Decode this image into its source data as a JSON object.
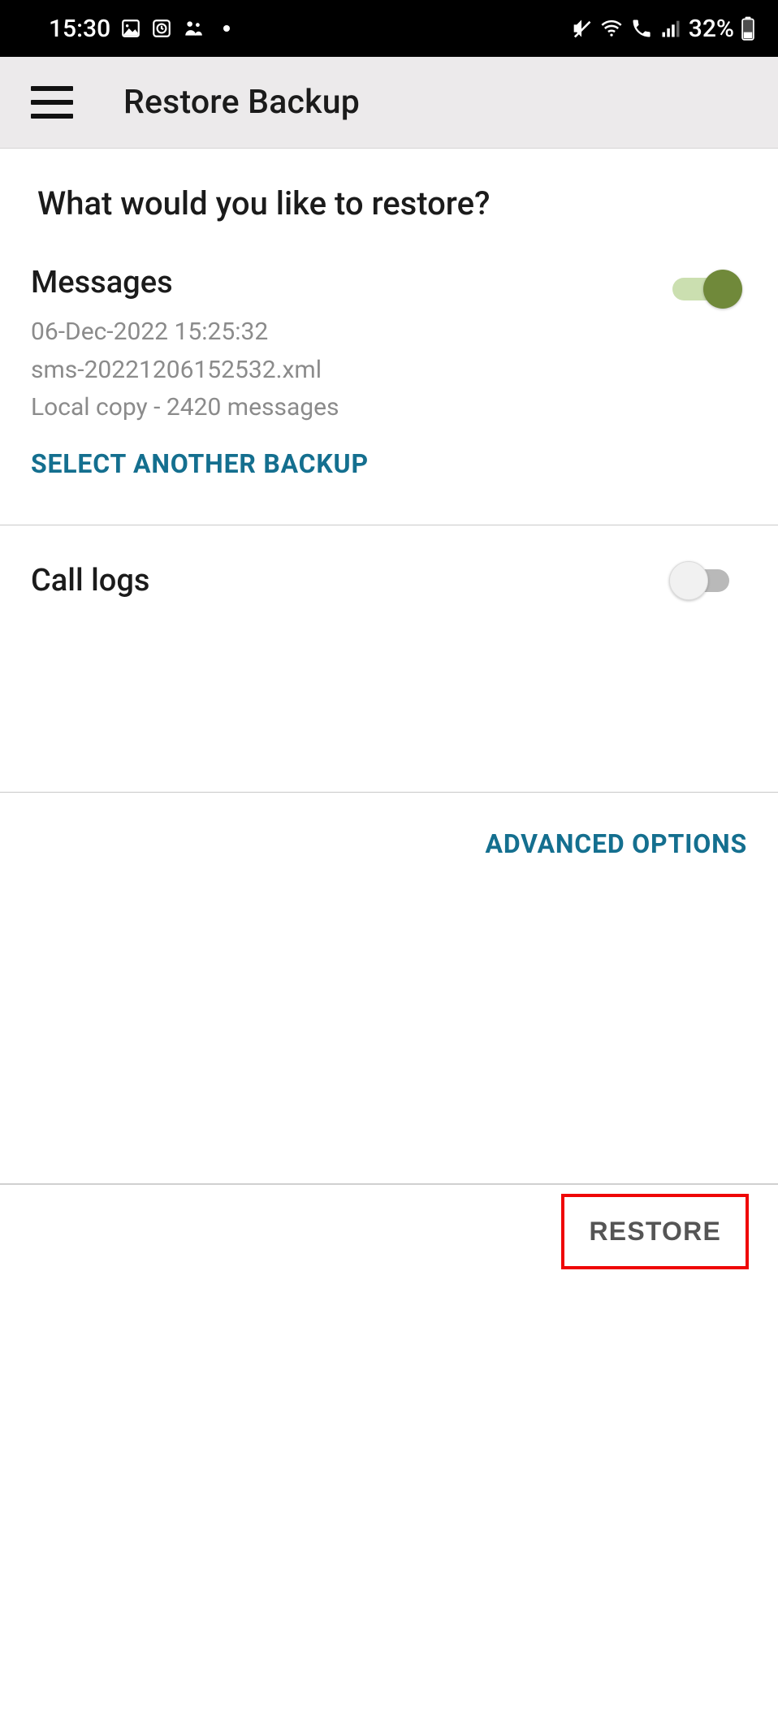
{
  "status_bar": {
    "time": "15:30",
    "battery_text": "32%"
  },
  "app_bar": {
    "title": "Restore Backup"
  },
  "prompt": "What would you like to restore?",
  "messages_section": {
    "title": "Messages",
    "line1": "06-Dec-2022 15:25:32",
    "line2": "sms-20221206152532.xml",
    "line3": "Local copy - 2420 messages",
    "select_another_label": "SELECT ANOTHER BACKUP",
    "toggle_on": true
  },
  "call_logs_section": {
    "title": "Call logs",
    "toggle_on": false
  },
  "advanced_options_label": "ADVANCED OPTIONS",
  "footer": {
    "restore_label": "RESTORE"
  }
}
